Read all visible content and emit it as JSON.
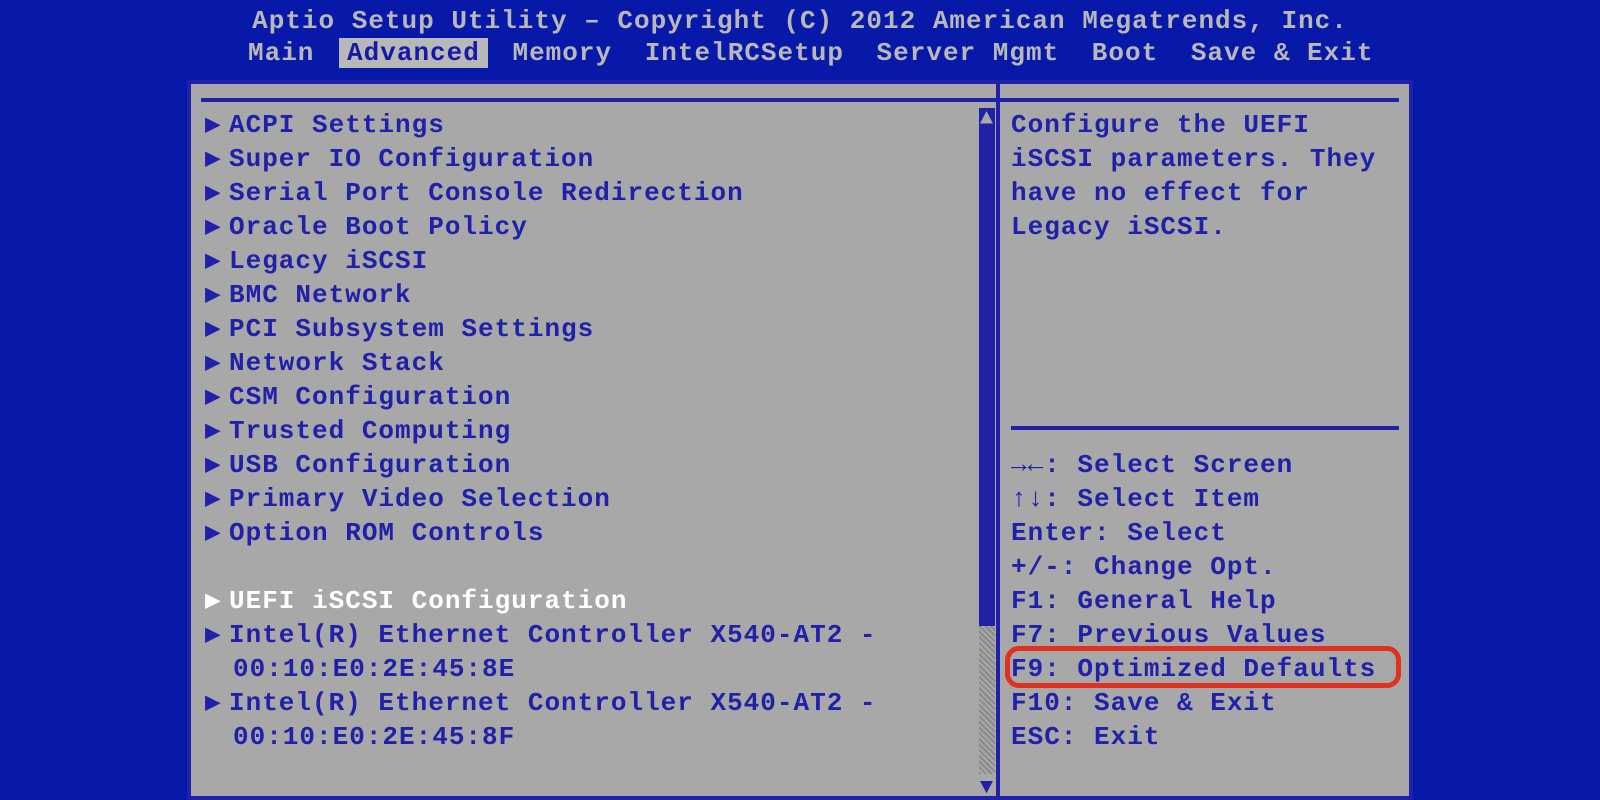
{
  "title": "Aptio Setup Utility – Copyright (C) 2012 American Megatrends, Inc.",
  "tabs": [
    "Main",
    "Advanced",
    "Memory",
    "IntelRCSetup",
    "Server Mgmt",
    "Boot",
    "Save & Exit"
  ],
  "active_tab_index": 1,
  "menu": [
    {
      "type": "item",
      "label": "ACPI Settings"
    },
    {
      "type": "item",
      "label": "Super IO Configuration"
    },
    {
      "type": "item",
      "label": "Serial Port Console Redirection"
    },
    {
      "type": "item",
      "label": "Oracle Boot Policy"
    },
    {
      "type": "item",
      "label": "Legacy iSCSI"
    },
    {
      "type": "item",
      "label": "BMC Network"
    },
    {
      "type": "item",
      "label": "PCI Subsystem Settings"
    },
    {
      "type": "item",
      "label": "Network Stack"
    },
    {
      "type": "item",
      "label": "CSM Configuration"
    },
    {
      "type": "item",
      "label": "Trusted Computing"
    },
    {
      "type": "item",
      "label": "USB Configuration"
    },
    {
      "type": "item",
      "label": "Primary Video Selection"
    },
    {
      "type": "item",
      "label": "Option ROM Controls"
    },
    {
      "type": "blank"
    },
    {
      "type": "item",
      "label": "UEFI iSCSI Configuration",
      "selected": true
    },
    {
      "type": "item",
      "label": "Intel(R) Ethernet Controller X540-AT2 -",
      "sub": "00:10:E0:2E:45:8E"
    },
    {
      "type": "item",
      "label": "Intel(R) Ethernet Controller X540-AT2 -",
      "sub": "00:10:E0:2E:45:8F"
    }
  ],
  "help_text": "Configure the UEFI iSCSI parameters. They have no effect for Legacy iSCSI.",
  "key_help": [
    "→←: Select Screen",
    "↑↓: Select Item",
    "Enter: Select",
    "+/-: Change Opt.",
    "F1: General Help",
    "F7: Previous Values",
    "F9: Optimized Defaults",
    "F10: Save & Exit",
    "ESC: Exit"
  ],
  "highlight_key_index": 6
}
